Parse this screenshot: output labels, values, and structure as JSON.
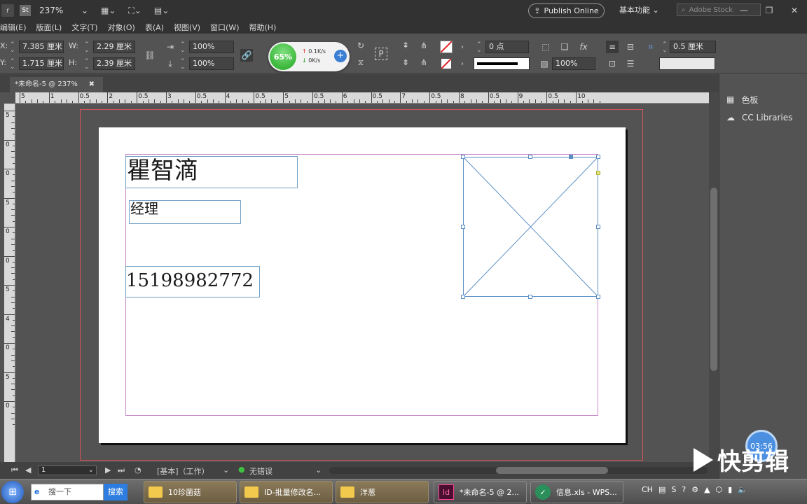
{
  "appbar": {
    "logo": "r",
    "st": "St",
    "zoom": "237%",
    "publish": "Publish Online",
    "workspace": "基本功能",
    "stock_placeholder": "Adobe Stock"
  },
  "menu": [
    "编辑(E)",
    "版面(L)",
    "文字(T)",
    "对象(O)",
    "表(A)",
    "视图(V)",
    "窗口(W)",
    "帮助(H)"
  ],
  "control": {
    "x_label": "X:",
    "x_value": "7.385 厘米",
    "y_label": "Y:",
    "y_value": "1.715 厘米",
    "w_label": "W:",
    "w_value": "2.29 厘米",
    "h_label": "H:",
    "h_value": "2.39 厘米",
    "scale_x": "100%",
    "scale_y": "100%",
    "stroke_weight": "0 点",
    "opacity": "100%",
    "offset": "0.5 厘米",
    "paragraph_glyph": "P"
  },
  "net_widget": {
    "percent": "65%",
    "up": "0.1K/s",
    "down": "0K/s"
  },
  "tab": {
    "title": "*未命名-5 @ 237%"
  },
  "ruler": {
    "h_labels": [
      "5",
      "1",
      "0.5",
      "2",
      "0.5",
      "3",
      "0.5",
      "4",
      "0.5",
      "5",
      "0.5",
      "6",
      "0.5",
      "7",
      "0.5",
      "8",
      "0.5",
      "9",
      "0.5",
      "10"
    ],
    "v_labels": [
      "5",
      "0",
      "0",
      "5",
      "0",
      "0",
      "5",
      "4",
      "0",
      "5",
      "0"
    ]
  },
  "document": {
    "name_text": "瞿智滴",
    "title_text": "经理",
    "phone_text": "15198982772"
  },
  "panel": {
    "swatches": "色板",
    "libraries": "CC Libraries"
  },
  "status": {
    "page": "1",
    "style": "[基本]（工作）",
    "preflight": "无错误"
  },
  "overlay": {
    "timer": "03:56",
    "watermark": "快剪辑"
  },
  "taskbar": {
    "search_placeholder": "搜一下",
    "search_button": "搜索",
    "items": [
      "10珍菌菇",
      "ID-批量修改名...",
      "洋葱",
      "*未命名-5 @ 2...",
      "信息.xls - WPS..."
    ],
    "ind_icon": "Id",
    "tray_text": "CH"
  }
}
